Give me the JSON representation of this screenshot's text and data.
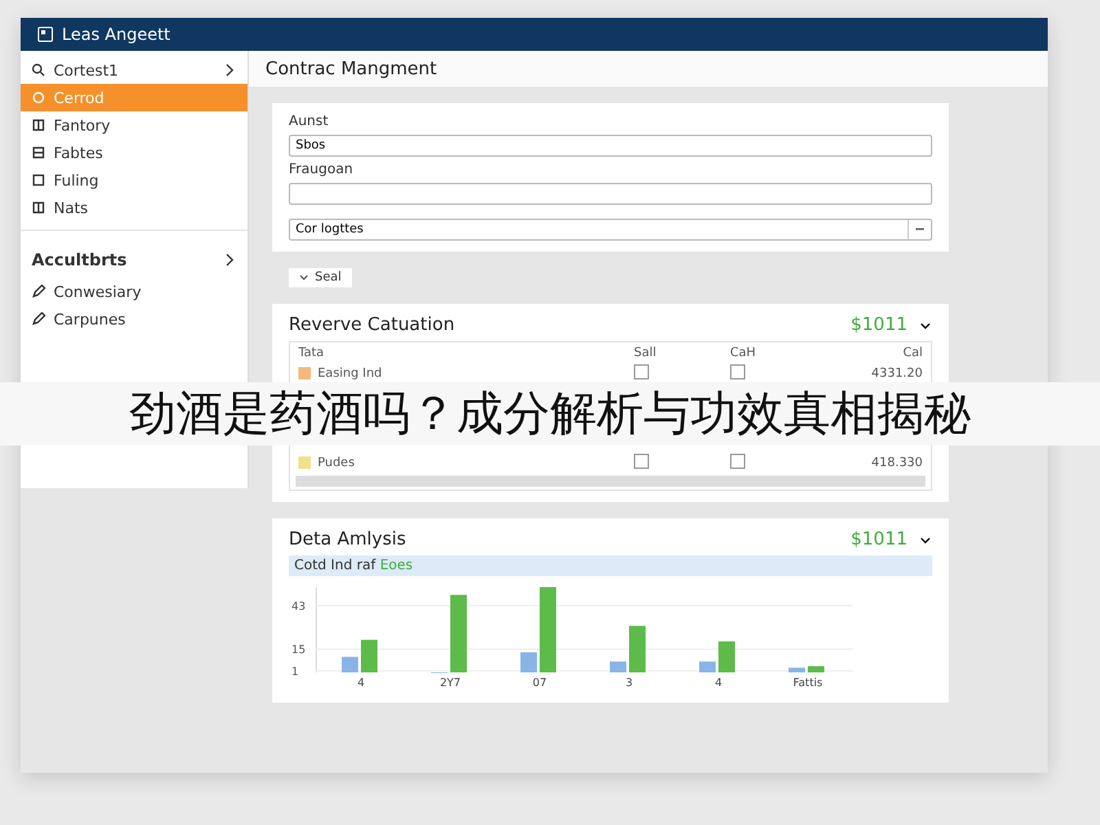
{
  "window": {
    "title": "Leas Angeett"
  },
  "sidebar": {
    "search": {
      "label": "Cortest1"
    },
    "items": [
      {
        "label": "Cerrod",
        "selected": true
      },
      {
        "label": "Fantory",
        "selected": false
      },
      {
        "label": "Fabtes",
        "selected": false
      },
      {
        "label": "Fuling",
        "selected": false
      },
      {
        "label": "Nats",
        "selected": false
      }
    ],
    "section": {
      "title": "Accultbrts"
    },
    "section_items": [
      {
        "label": "Conwesiary"
      },
      {
        "label": "Carpunes"
      }
    ]
  },
  "page_title": "Contrac Mangment",
  "form": {
    "fields": [
      {
        "kind": "text",
        "label": "Aunst",
        "value": "Sbos"
      },
      {
        "kind": "text",
        "label": "Fraugoan"
      },
      {
        "kind": "select",
        "value": "Cor logttes"
      }
    ],
    "button": "Seal"
  },
  "revenue": {
    "title": "Reverve Catuation",
    "amount": "$1011",
    "columns": [
      "Tata",
      "Sall",
      "CaH",
      "Cal"
    ],
    "rows": [
      {
        "name": "Easing Ind",
        "color": "#f5b97a",
        "sall": false,
        "cah": false,
        "value": "4331.20"
      },
      {
        "name": "Pudes",
        "color": "#f2e08a",
        "sall": false,
        "cah": false,
        "value": "418.330"
      }
    ]
  },
  "analysis": {
    "title": "Deta Amlysis",
    "amount": "$1011",
    "subtitle": "Cotd Ind raf",
    "subtitle_highlight": "Eoes",
    "chart_data": {
      "type": "bar",
      "categories": [
        "4",
        "2Y7",
        "07",
        "3",
        "4",
        "Fattis"
      ],
      "series": [
        {
          "color": "#8ab4e8",
          "values": [
            10,
            0,
            13,
            7,
            7,
            3
          ]
        },
        {
          "color": "#5dbb4a",
          "values": [
            21,
            50,
            55,
            30,
            20,
            4
          ]
        }
      ],
      "ylim": [
        0,
        55
      ],
      "yticks": [
        1,
        15,
        43
      ]
    }
  },
  "banner": {
    "text": "劲酒是药酒吗？成分解析与功效真相揭秘"
  }
}
